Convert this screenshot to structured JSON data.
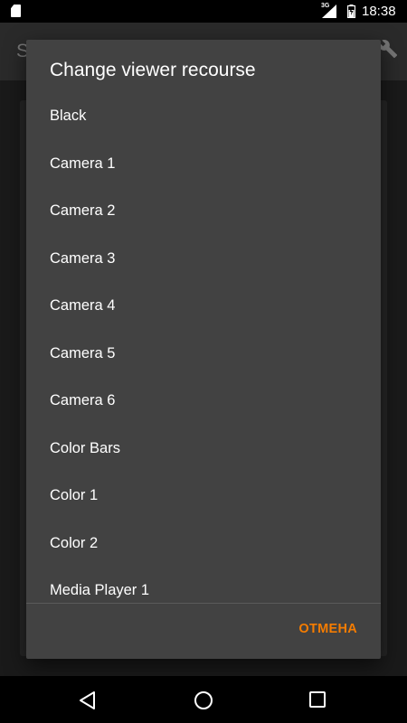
{
  "status_bar": {
    "time": "18:38",
    "network": "3G",
    "icons": [
      "sd-card-icon",
      "signal-icon",
      "battery-icon"
    ]
  },
  "background_app": {
    "title_partial": "S",
    "icon": "wrench-icon"
  },
  "dialog": {
    "title": "Change viewer recourse",
    "items": [
      {
        "label": "Black"
      },
      {
        "label": "Camera 1"
      },
      {
        "label": "Camera 2"
      },
      {
        "label": "Camera 3"
      },
      {
        "label": "Camera 4"
      },
      {
        "label": "Camera 5"
      },
      {
        "label": "Camera 6"
      },
      {
        "label": "Color Bars"
      },
      {
        "label": "Color 1"
      },
      {
        "label": "Color 2"
      },
      {
        "label": "Media Player 1"
      }
    ],
    "cancel_label": "ОТМЕНА",
    "accent_color": "#f57c00"
  },
  "nav_bar": {
    "icons": [
      "back-icon",
      "home-icon",
      "recents-icon"
    ]
  }
}
